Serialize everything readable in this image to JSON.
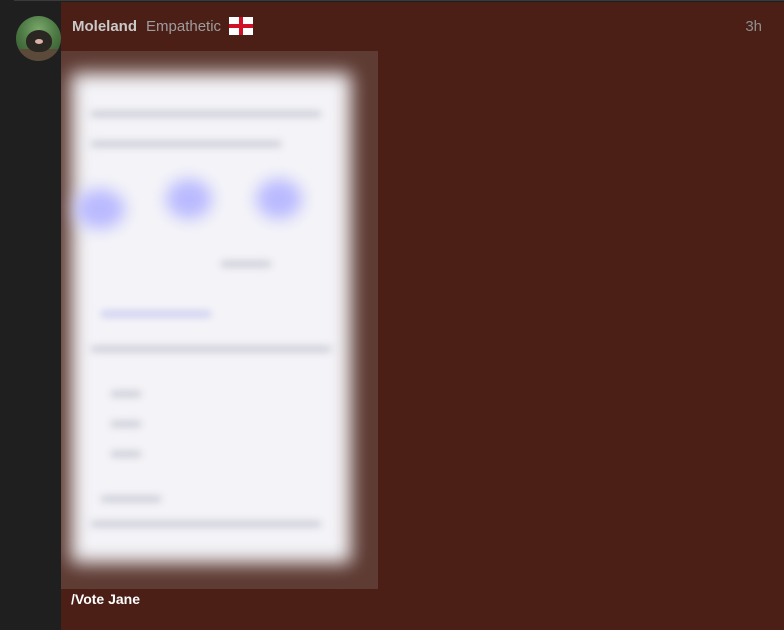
{
  "post": {
    "author": "Moleland",
    "flair": "Empathetic",
    "flag_icon": "england-flag-icon",
    "time_ago": "3h",
    "body": "/Vote Jane"
  },
  "colors": {
    "post_background": "#4b1f16",
    "page_background": "#1f1f1f"
  }
}
